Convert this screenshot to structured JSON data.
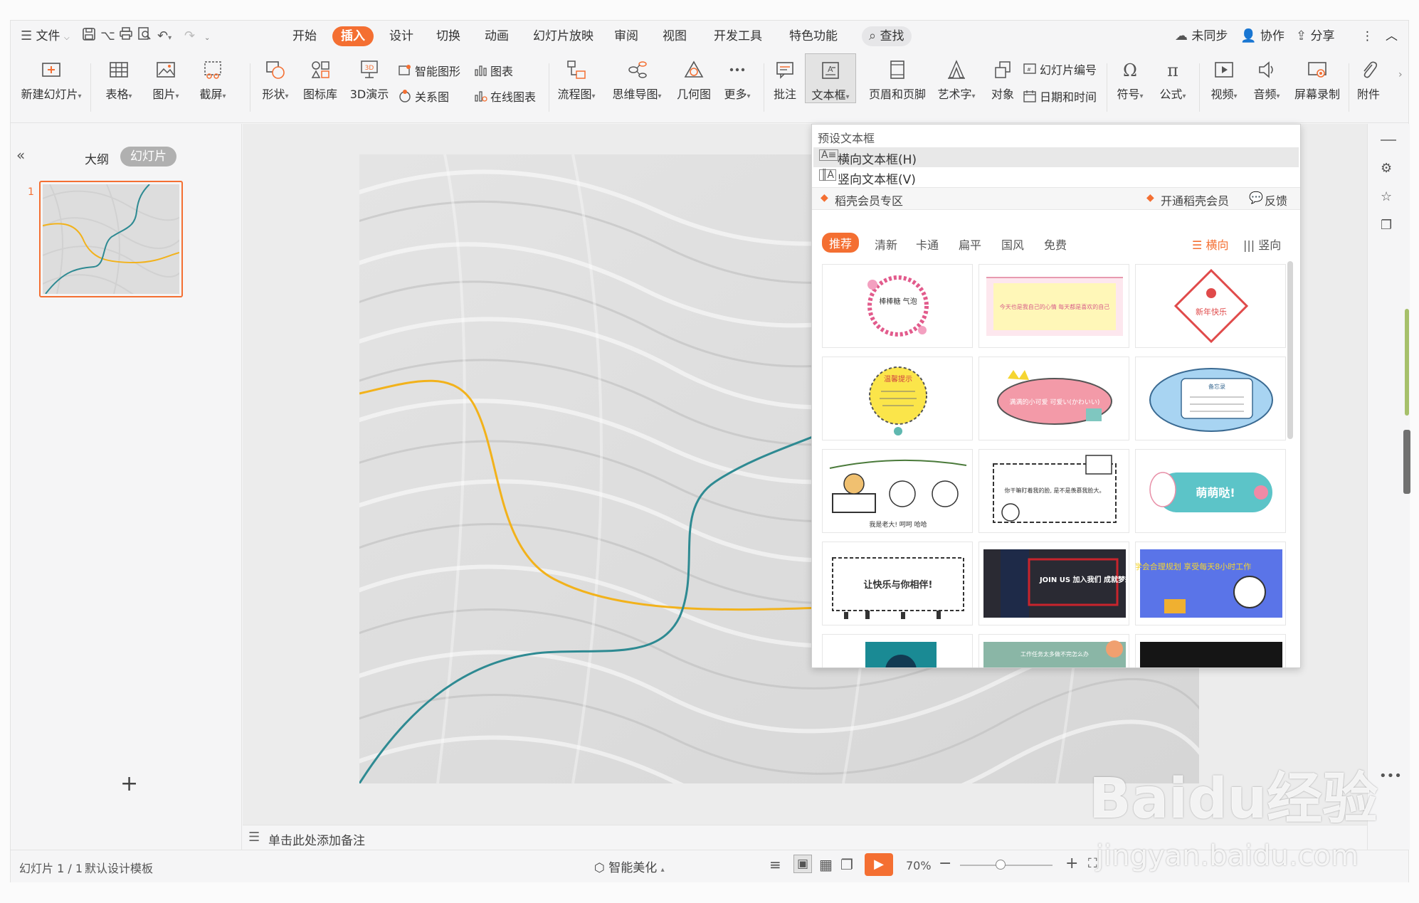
{
  "menubar": {
    "file_label": "文件",
    "tabs": [
      "开始",
      "插入",
      "设计",
      "切换",
      "动画",
      "幻灯片放映",
      "审阅",
      "视图",
      "开发工具",
      "特色功能"
    ],
    "search_label": "查找",
    "sync_label": "未同步",
    "collab_label": "协作",
    "share_label": "分享"
  },
  "ribbon": {
    "new_slide": "新建幻灯片",
    "table": "表格",
    "picture": "图片",
    "screenshot": "截屏",
    "shape": "形状",
    "icon_lib": "图标库",
    "demo3d": "3D演示",
    "smart_shape": "智能图形",
    "chart": "图表",
    "relation": "关系图",
    "online_chart": "在线图表",
    "flowchart": "流程图",
    "mindmap": "思维导图",
    "geometry": "几何图",
    "more": "更多",
    "comment": "批注",
    "textbox": "文本框",
    "header_footer": "页眉和页脚",
    "wordart": "艺术字",
    "object": "对象",
    "slide_number": "幻灯片编号",
    "datetime": "日期和时间",
    "symbol": "符号",
    "formula": "公式",
    "video": "视频",
    "audio": "音频",
    "screen_record": "屏幕录制",
    "attachment": "附件"
  },
  "left_panel": {
    "outline_tab": "大纲",
    "slides_tab": "幻灯片",
    "slide_number": "1",
    "add_symbol": "+"
  },
  "notes": {
    "placeholder": "单击此处添加备注"
  },
  "status": {
    "slide_info": "幻灯片 1 / 1",
    "template": "默认设计模板",
    "beautify": "智能美化",
    "zoom": "70%"
  },
  "dropdown": {
    "preset_title": "预设文本框",
    "horizontal": "横向文本框(H)",
    "vertical": "竖向文本框(V)",
    "member_zone": "稻壳会员专区",
    "open_member": "开通稻壳会员",
    "feedback": "反馈",
    "filters": [
      "推荐",
      "清新",
      "卡通",
      "扁平",
      "国风",
      "免费"
    ],
    "orient_h": "横向",
    "orient_v": "竖向",
    "templates": [
      {
        "text": "棒棒糖\n气泡"
      },
      {
        "text": "今天也是我自己的心情\n每天都是喜欢的自己"
      },
      {
        "text": "新年快乐"
      },
      {
        "text": "温馨提示"
      },
      {
        "text": "满满的小可爱 可爱い(かわいい)"
      },
      {
        "text": "备忘录"
      },
      {
        "text": "我是老大! 呵呵 哈哈"
      },
      {
        "text": "你干嘛盯着我的脸, 是不是羡慕我脸大。"
      },
      {
        "text": "萌萌哒!"
      },
      {
        "text": "让快乐与你相伴!"
      },
      {
        "text": "JOIN US 加入我们 成就梦想"
      },
      {
        "text": "学会合理规划 享受每天8小时工作"
      },
      {
        "text": ""
      },
      {
        "text": "工作任务太多做不完怎么办"
      },
      {
        "text": ""
      }
    ]
  },
  "watermark": {
    "brand": "Baidu经验",
    "url": "jingyan.baidu.com"
  },
  "colors": {
    "accent": "#f46f32",
    "yellow_curve": "#f2b21b",
    "teal_curve": "#2e8a92"
  }
}
